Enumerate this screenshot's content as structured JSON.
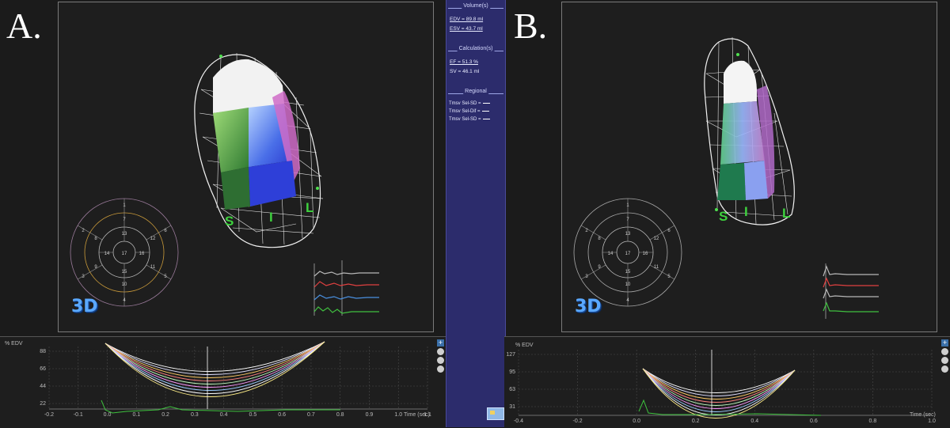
{
  "panels": {
    "A": {
      "letter": "A.",
      "labels": {
        "s": "S",
        "i": "I",
        "l": "L"
      },
      "badge": "3D",
      "bullseye_segments": [
        "1",
        "7",
        "2",
        "6",
        "8",
        "13",
        "12",
        "3",
        "9",
        "14",
        "17",
        "16",
        "11",
        "5",
        "15",
        "10",
        "4"
      ],
      "curve": {
        "y_axis_title": "% EDV",
        "y_ticks": [
          "88",
          "66",
          "44",
          "22"
        ],
        "x_ticks": [
          "-0.2",
          "-0.1",
          "0.0",
          "0.1",
          "0.2",
          "0.3",
          "0.4",
          "0.5",
          "0.6",
          "0.7",
          "0.8",
          "0.9",
          "1.0",
          "1.1"
        ],
        "x_axis_title": "Time (sec)"
      }
    },
    "B": {
      "letter": "B.",
      "labels": {
        "s": "S",
        "i": "I",
        "l": "L"
      },
      "badge": "3D",
      "bullseye_segments": [
        "1",
        "7",
        "2",
        "6",
        "8",
        "13",
        "12",
        "3",
        "9",
        "14",
        "17",
        "16",
        "11",
        "5",
        "15",
        "10",
        "4"
      ],
      "curve": {
        "y_axis_title": "% EDV",
        "y_ticks": [
          "127",
          "95",
          "63",
          "31"
        ],
        "x_ticks": [
          "-0.4",
          "-0.2",
          "0.0",
          "0.2",
          "0.4",
          "0.6",
          "0.8",
          "1.0"
        ],
        "x_axis_title": "Time (sec)"
      }
    }
  },
  "results": {
    "volume_header": "Volume(s)",
    "edv": "EDV = 89.8 ml",
    "esv": "ESV = 43.7 ml",
    "calc_header": "Calculation(s)",
    "ef": "EF = 51.3 %",
    "sv": "SV = 46.1 ml",
    "regional_header": "Regional",
    "regional_rows": [
      "Tmsv Sel-SD =",
      "Tmsv Sel-Dif =",
      "Tmsv Sel-SD ="
    ]
  },
  "colors": {
    "curve_bg": "#1e1e1e",
    "grid": "#4a4a4a",
    "green_trace": "#3ec23e",
    "panel_bg": "#2c2c6c"
  }
}
